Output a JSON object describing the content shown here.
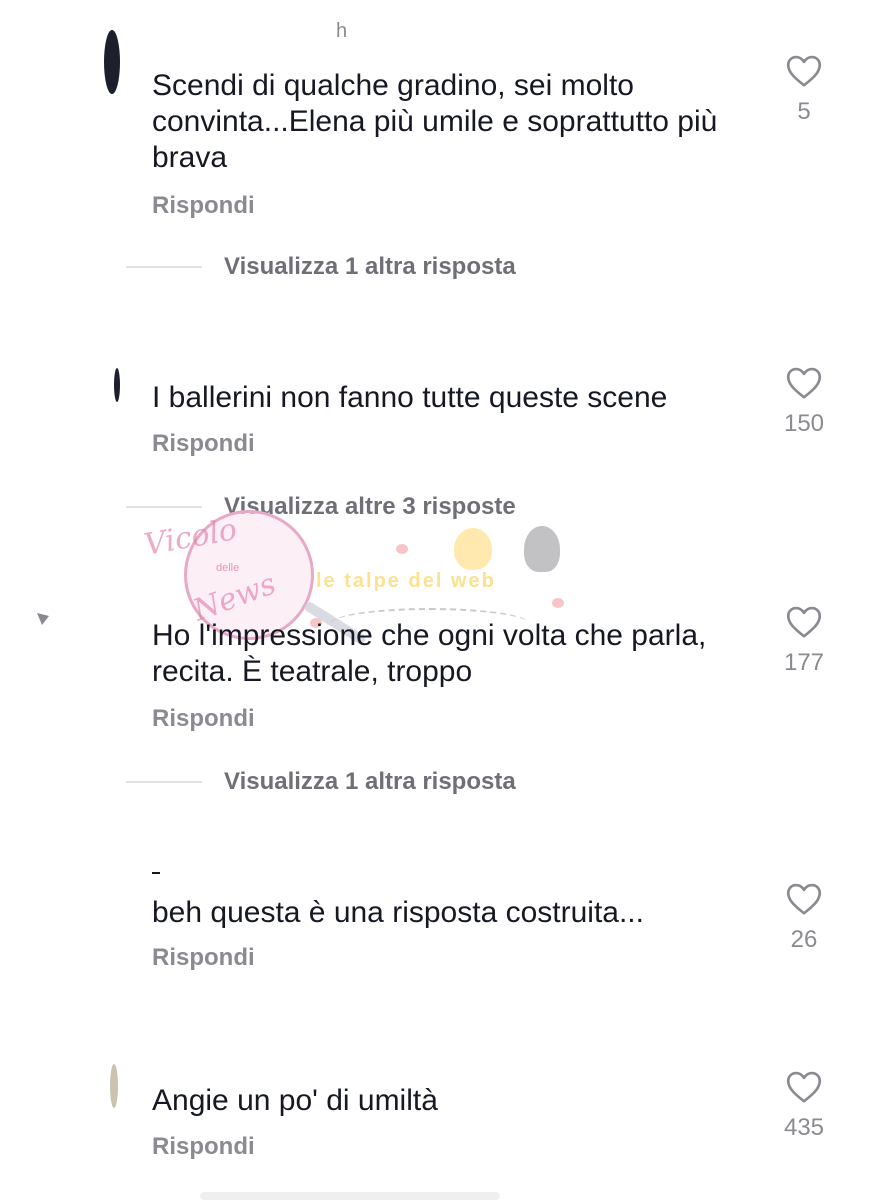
{
  "comments": [
    {
      "username": "h",
      "text": "Scendi di qualche gradino, sei molto convinta...Elena più umile e soprattutto più brava",
      "reply_label": "Rispondi",
      "likes": "5",
      "view_replies": "Visualizza 1 altra risposta"
    },
    {
      "username": "",
      "text": "I ballerini non fanno tutte queste scene",
      "reply_label": "Rispondi",
      "likes": "150",
      "view_replies": "Visualizza altre 3 risposte"
    },
    {
      "username": "",
      "text": "Ho l'impressione che ogni volta che parla, recita. È teatrale, troppo",
      "reply_label": "Rispondi",
      "likes": "177",
      "view_replies": "Visualizza 1 altra risposta"
    },
    {
      "username": "",
      "text": "beh questa è una risposta costruita...",
      "reply_label": "Rispondi",
      "likes": "26"
    },
    {
      "username": "",
      "text": "Angie un po' di umiltà",
      "reply_label": "Rispondi",
      "likes": "435"
    }
  ],
  "watermark": {
    "brand_main": "Vicolo",
    "brand_small": "delle",
    "brand_end": "News",
    "banner": "le talpe del web"
  },
  "icons": {
    "like": "heart-outline-icon"
  },
  "colors": {
    "text": "#161823",
    "muted": "#8a8b91",
    "reply_link": "#6f7077"
  }
}
